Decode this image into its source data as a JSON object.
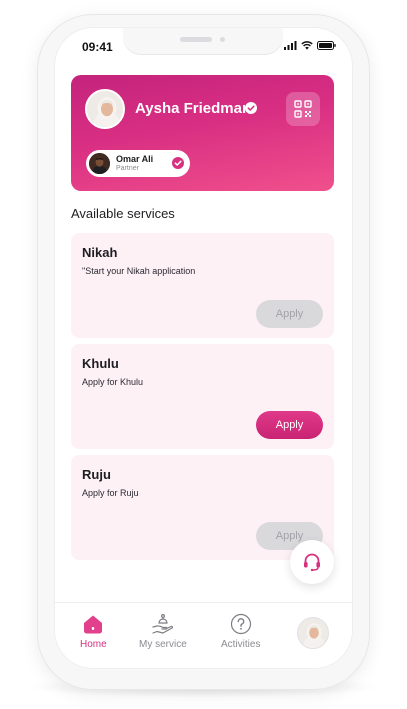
{
  "status_bar": {
    "time": "09:41"
  },
  "profile": {
    "name": "Aysha Friedman",
    "partner": {
      "name": "Omar Ali",
      "role": "Partner"
    }
  },
  "services": {
    "title": "Available services",
    "items": [
      {
        "name": "Nikah",
        "description": "\"Start your Nikah application",
        "button": "Apply",
        "state": "disabled"
      },
      {
        "name": "Khulu",
        "description": "Apply for Khulu",
        "button": "Apply",
        "state": "active"
      },
      {
        "name": "Ruju",
        "description": "Apply for Ruju",
        "button": "Apply",
        "state": "disabled"
      }
    ]
  },
  "nav": {
    "items": [
      {
        "label": "Home",
        "icon": "home-icon",
        "active": true
      },
      {
        "label": "My service",
        "icon": "hands-icon",
        "active": false
      },
      {
        "label": "Activities",
        "icon": "question-circle-icon",
        "active": false
      }
    ]
  },
  "colors": {
    "brand_gradient_start": "#c4237c",
    "brand_gradient_end": "#f0508c",
    "accent": "#d6307f",
    "card_background": "#fdf1f6",
    "disabled_button": "#d9d9db"
  }
}
